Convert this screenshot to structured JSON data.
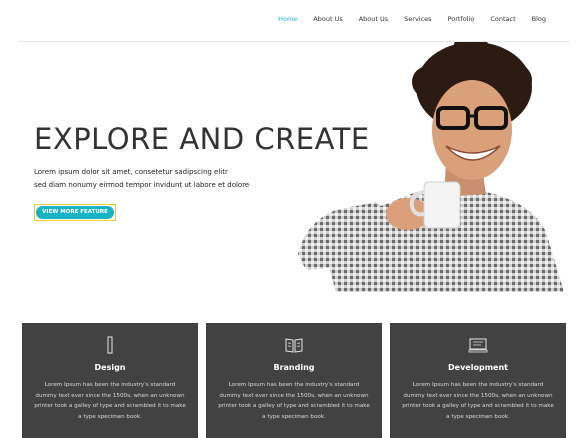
{
  "nav": {
    "items": [
      {
        "label": "Home",
        "active": true
      },
      {
        "label": "About Us",
        "active": false
      },
      {
        "label": "About Us",
        "active": false
      },
      {
        "label": "Services",
        "active": false
      },
      {
        "label": "Portfolio",
        "active": false
      },
      {
        "label": "Contact",
        "active": false
      },
      {
        "label": "Blog",
        "active": false
      }
    ],
    "active_color": "#1cb5c6"
  },
  "hero": {
    "title": "EXPLORE AND CREATE",
    "text_line1": "Lorem ipsum dolor sit amet, consetetur sadipscing elitr",
    "text_line2": "sed diam nonumy eirmod tempor invidunt ut labore et dolore",
    "button_label": "VIEW MORE FEATURE",
    "button_color": "#18b4c6"
  },
  "features": [
    {
      "icon": "pencil-icon",
      "title": "Design",
      "text": "Lorem Ipsum has been the industry's standard dummy text ever since the 1500s, when an unknown printer took a galley of type and scrambled it to make a type specimen book."
    },
    {
      "icon": "book-icon",
      "title": "Branding",
      "text": "Lorem Ipsum has been the industry's standard dummy text ever since the 1500s, when an unknown printer took a galley of type and scrambled it to make a type specimen book."
    },
    {
      "icon": "monitor-icon",
      "title": "Development",
      "text": "Lorem Ipsum has been the industry's standard dummy text ever since the 1500s, when an unknown printer took a galley of type and scrambled it to make a type specimen book."
    }
  ],
  "colors": {
    "feature_bg": "#424242"
  }
}
